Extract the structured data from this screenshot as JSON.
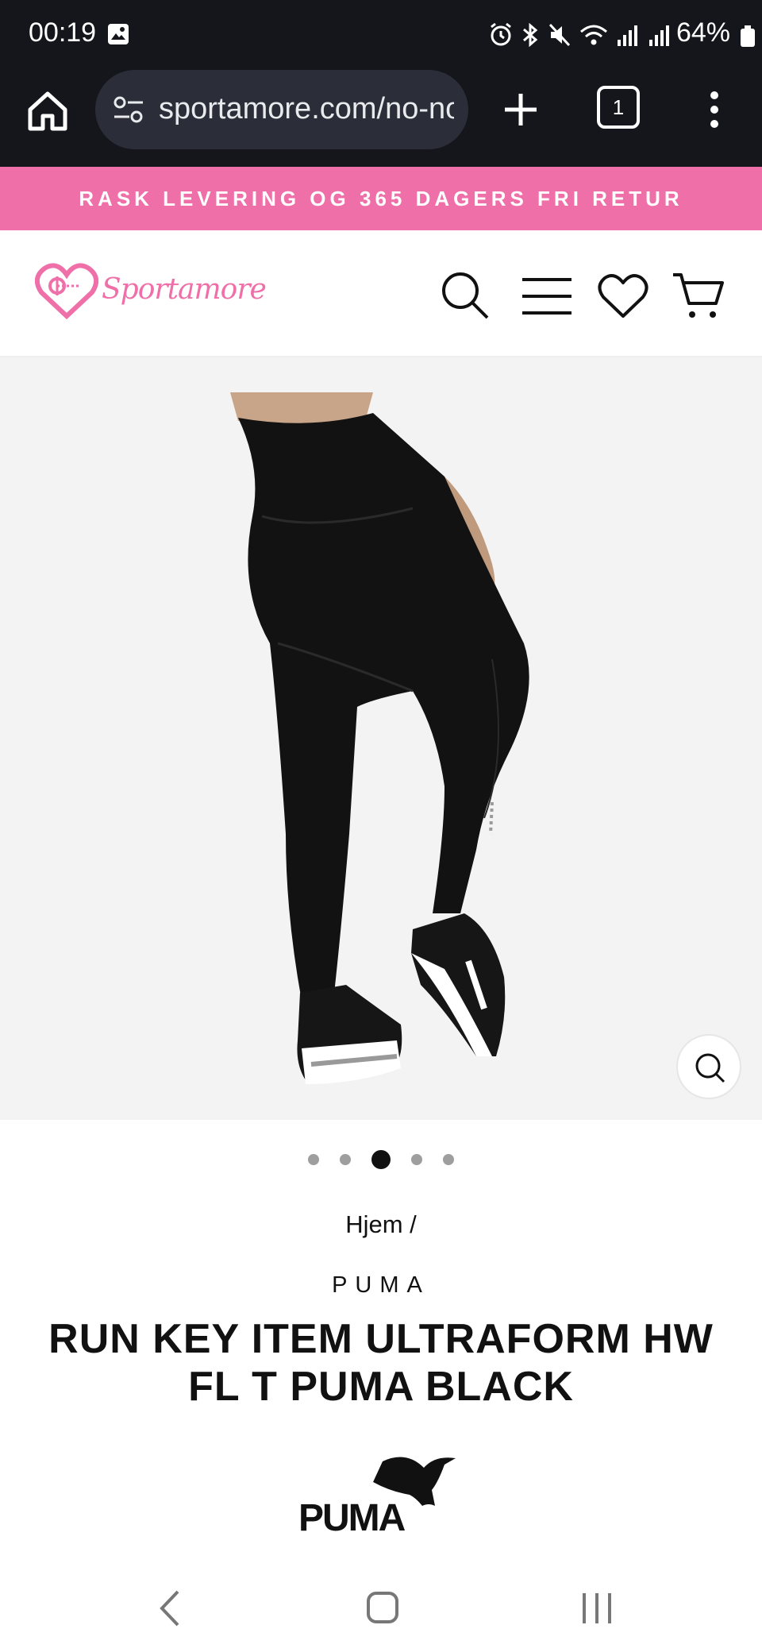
{
  "status_bar": {
    "time": "00:19",
    "battery": "64%"
  },
  "browser": {
    "url": "sportamore.com/no-no",
    "tab_count": "1"
  },
  "promo": {
    "text": "RASK LEVERING OG 365 DAGERS FRI RETUR"
  },
  "header": {
    "logo_text": "Sportamore"
  },
  "carousel": {
    "count": 5,
    "active": 3
  },
  "product": {
    "breadcrumb": "Hjem /",
    "brand": "PUMA",
    "title": "RUN KEY ITEM ULTRAFORM HW FL T PUMA BLACK",
    "brand_logo_text": "PUMA"
  },
  "colors": {
    "accent": "#ef6fa8",
    "status_bg": "#14161b"
  },
  "icons": [
    "home-icon",
    "tune-icon",
    "plus-icon",
    "tabs-icon",
    "more-vert-icon",
    "search-icon",
    "menu-icon",
    "heart-icon",
    "cart-icon",
    "zoom-icon",
    "back-icon",
    "home-nav-icon",
    "recents-icon"
  ]
}
